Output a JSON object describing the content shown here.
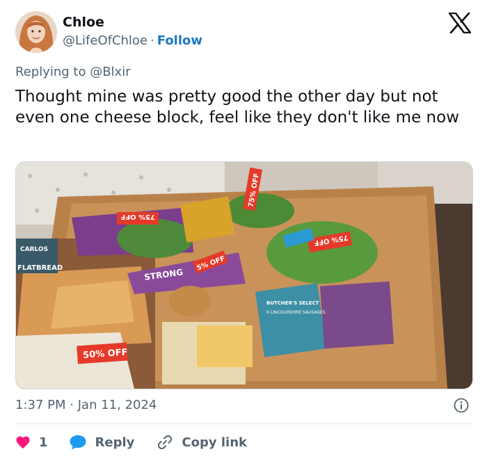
{
  "author": {
    "name": "Chloe",
    "handle": "@LifeOfChloe",
    "separator": "·",
    "follow_label": "Follow"
  },
  "reply_context": {
    "prefix": "Replying to ",
    "handle": "@Blxir"
  },
  "tweet": {
    "text": "Thought mine was pretty good the other day but not even one cheese block, feel like they don't like me now"
  },
  "media": {
    "labels": {
      "discount_50": "50% OFF",
      "discount_75_a": "75% OFF",
      "discount_75_b": "75% OFF",
      "discount_5": "5% OFF",
      "discount_75_c": "75% OFF",
      "brand_carlos": "CARLOS",
      "product_flatbread": "FLATBREAD",
      "product_strong": "STRONG",
      "product_butchers": "BUTCHER'S SELECT",
      "product_sausages": "6 LINCOLNSHIRE SAUSAGES"
    }
  },
  "meta": {
    "time": "1:37 PM",
    "separator": "·",
    "date": "Jan 11, 2024"
  },
  "actions": {
    "like_count": "1",
    "reply_label": "Reply",
    "copy_label": "Copy link"
  },
  "colors": {
    "accent": "#1d77bf",
    "like": "#f91880",
    "reply": "#1d9bf0",
    "muted": "#536471",
    "text": "#0f1419"
  }
}
